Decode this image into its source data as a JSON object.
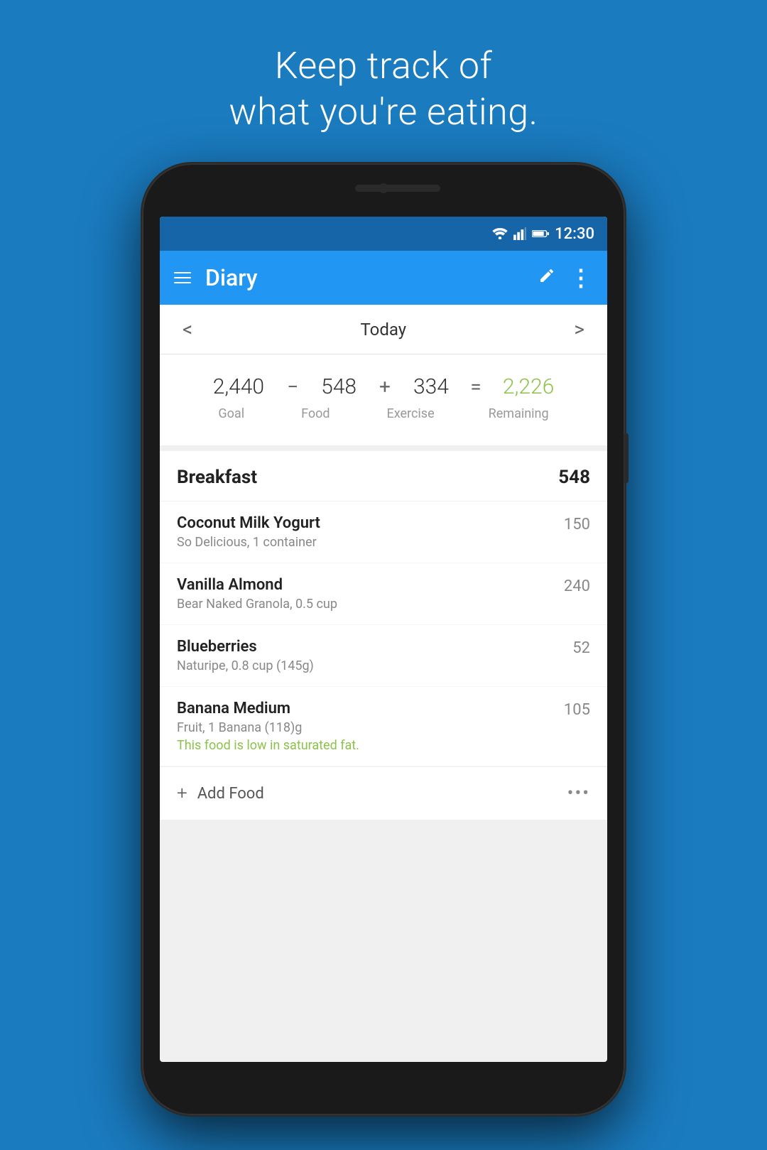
{
  "background_color": "#1a7bbf",
  "headline": {
    "line1": "Keep track of",
    "line2": "what you're eating."
  },
  "status_bar": {
    "time": "12:30",
    "icons": [
      "wifi",
      "signal",
      "battery"
    ]
  },
  "app_bar": {
    "title": "Diary",
    "edit_icon": "✏",
    "more_icon": "⋮"
  },
  "date_nav": {
    "prev_label": "<",
    "date_label": "Today",
    "next_label": ">"
  },
  "calorie_summary": {
    "goal": "2,440",
    "goal_label": "Goal",
    "minus": "−",
    "food": "548",
    "food_label": "Food",
    "plus": "+",
    "exercise": "334",
    "exercise_label": "Exercise",
    "equals": "=",
    "remaining": "2,226",
    "remaining_label": "Remaining"
  },
  "breakfast": {
    "title": "Breakfast",
    "calories": "548",
    "items": [
      {
        "name": "Coconut Milk Yogurt",
        "detail": "So Delicious, 1 container",
        "calories": "150",
        "note": ""
      },
      {
        "name": "Vanilla Almond",
        "detail": "Bear Naked Granola, 0.5 cup",
        "calories": "240",
        "note": ""
      },
      {
        "name": "Blueberries",
        "detail": "Naturipe, 0.8 cup (145g)",
        "calories": "52",
        "note": ""
      },
      {
        "name": "Banana Medium",
        "detail": "Fruit, 1 Banana (118)g",
        "calories": "105",
        "note": "This food is low in saturated fat."
      }
    ]
  },
  "add_food": {
    "icon": "+",
    "label": "Add Food",
    "more_icon": "•••"
  }
}
